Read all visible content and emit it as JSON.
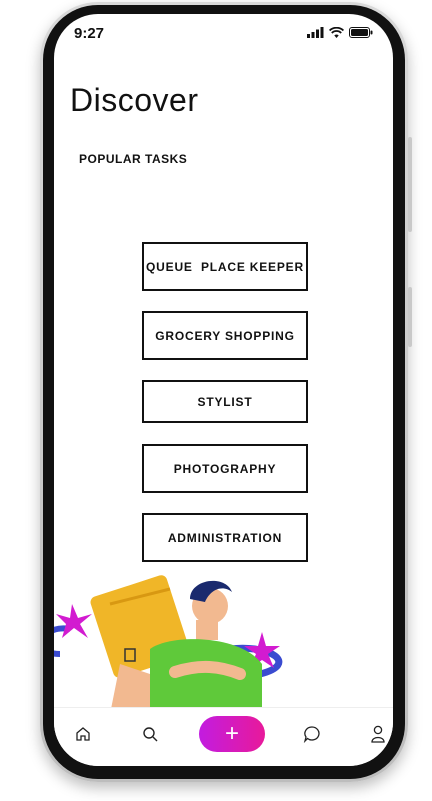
{
  "status_bar": {
    "time": "9:27"
  },
  "page": {
    "title": "Discover",
    "section_label": "POPULAR TASKS"
  },
  "tasks": [
    {
      "label": "QUEUE  PLACE KEEPER"
    },
    {
      "label": "GROCERY SHOPPING"
    },
    {
      "label": "STYLIST"
    },
    {
      "label": "PHOTOGRAPHY"
    },
    {
      "label": "ADMINISTRATION"
    }
  ],
  "tab_bar": {
    "items": [
      "home-icon",
      "search-icon",
      "add-icon",
      "chat-icon",
      "profile-icon"
    ],
    "fab_symbol": "+"
  },
  "colors": {
    "fab_start": "#c21ce0",
    "fab_end": "#e81a9a",
    "text": "#111111"
  }
}
